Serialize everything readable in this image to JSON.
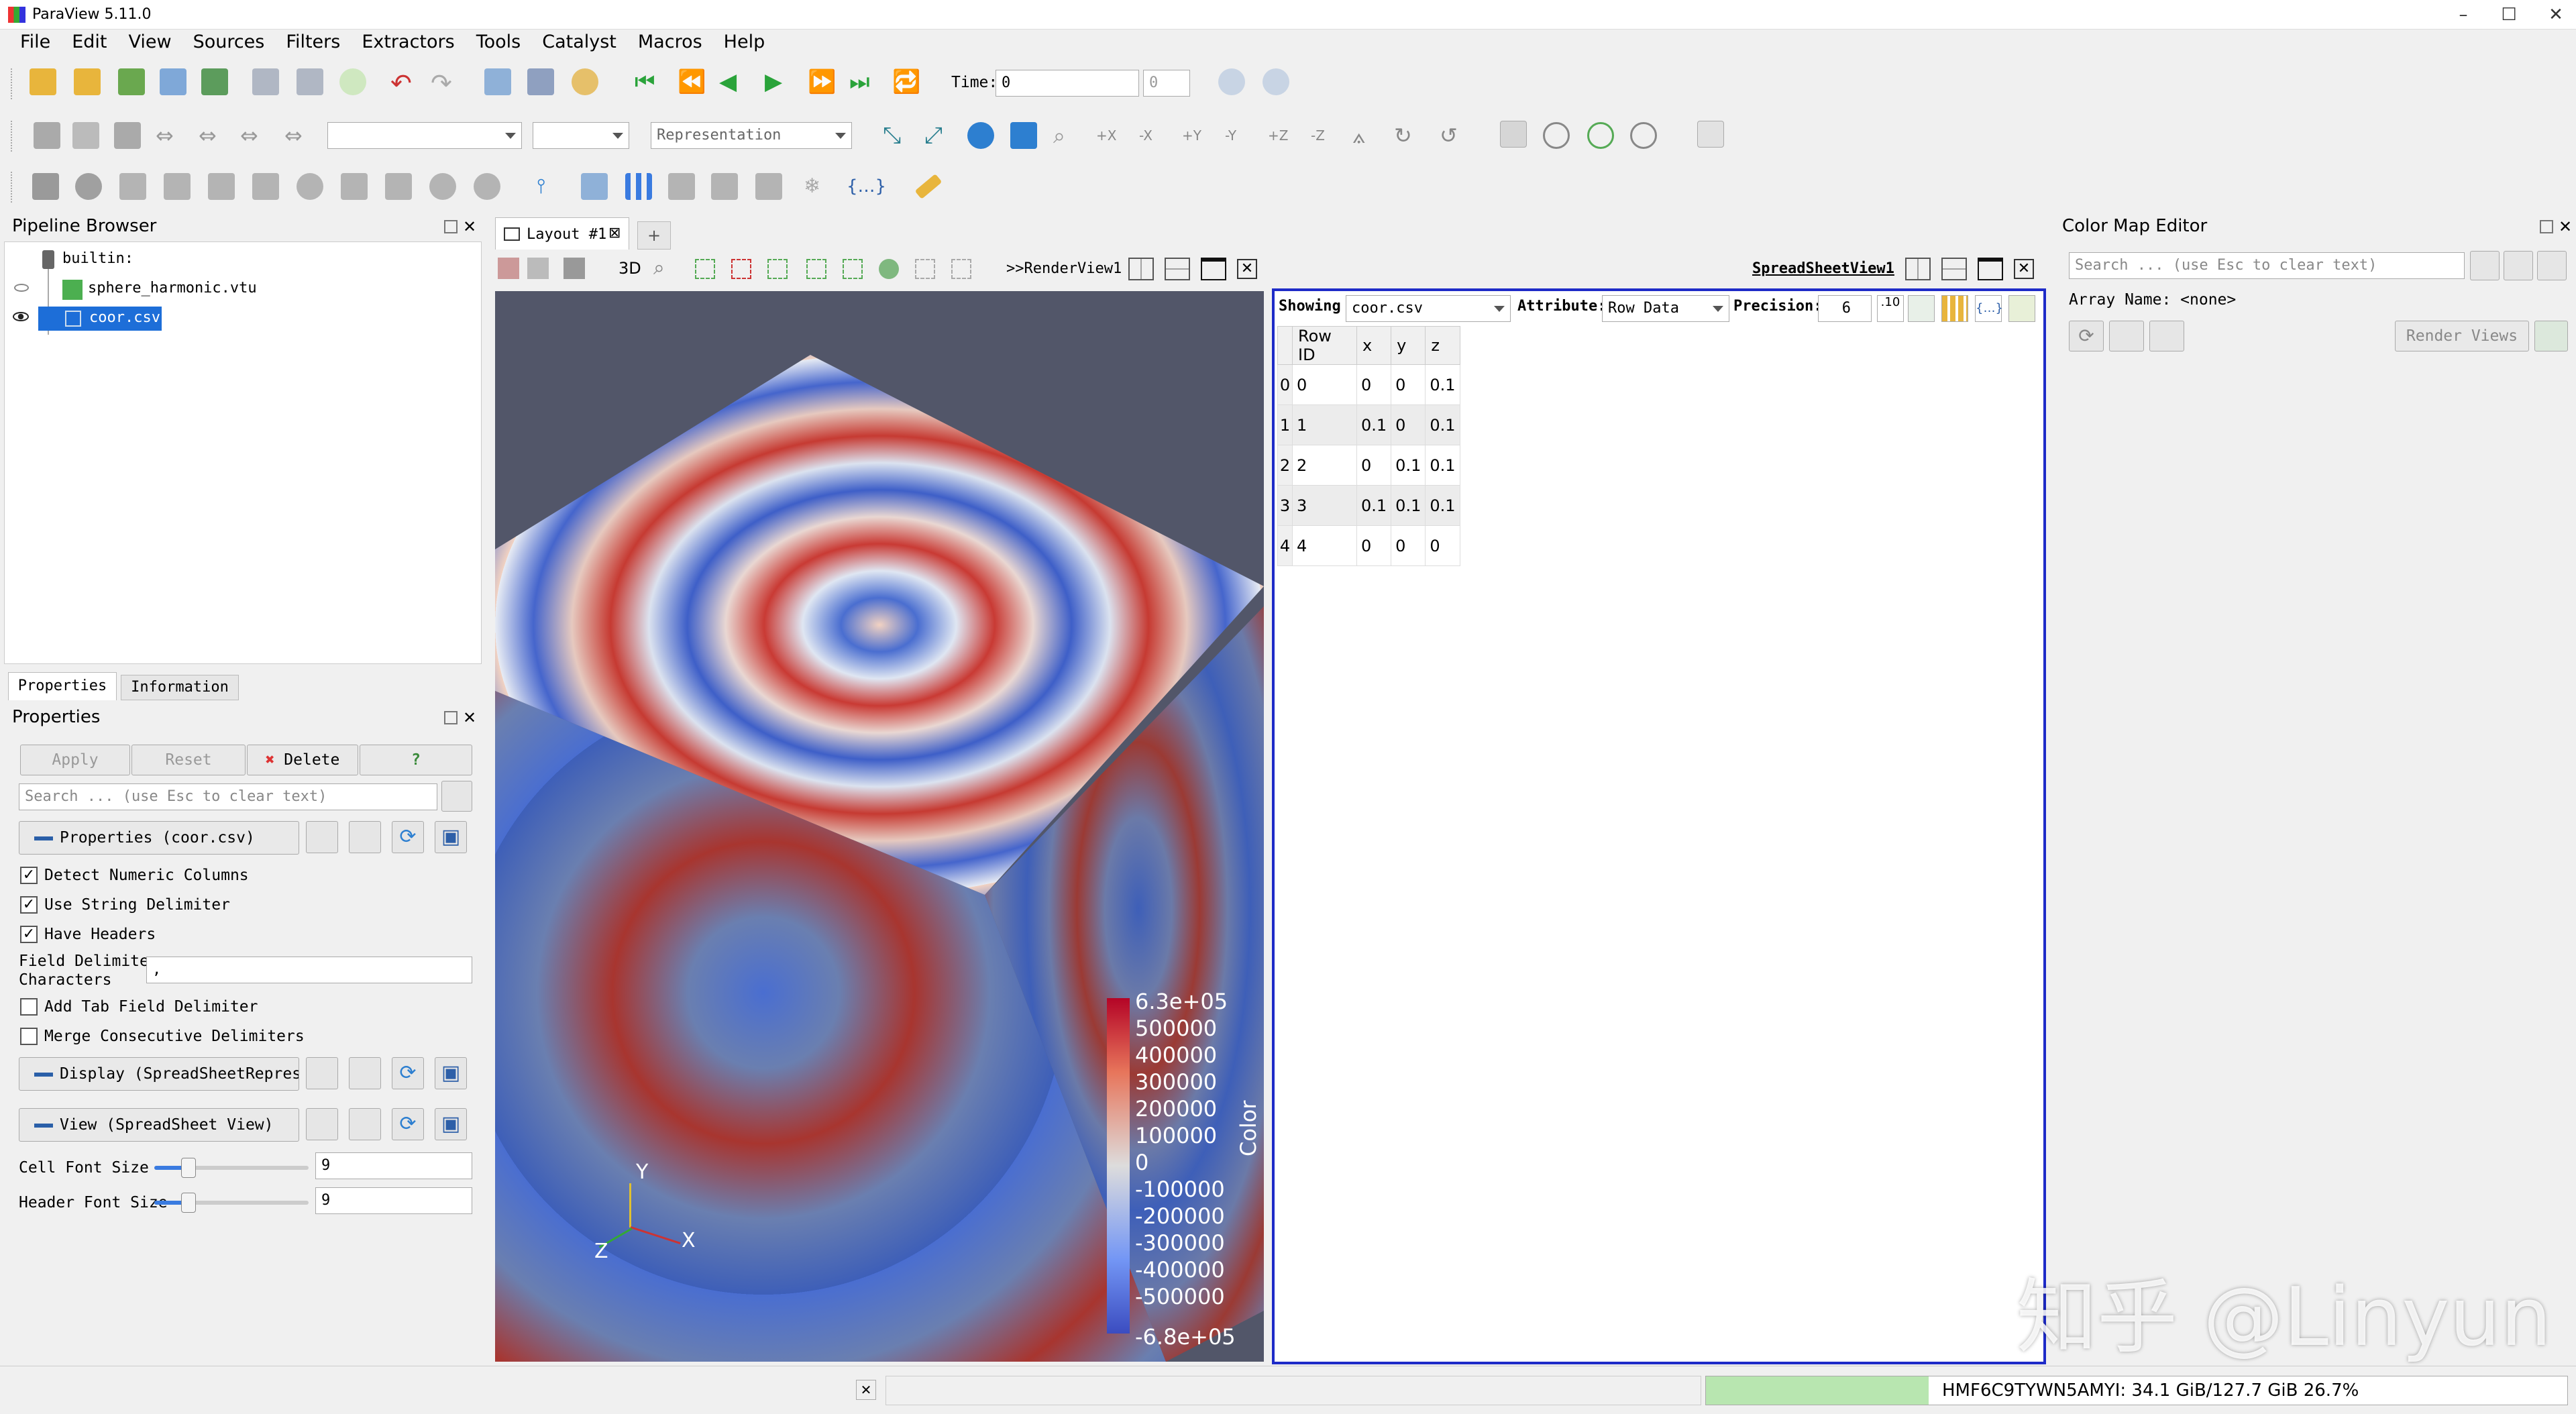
{
  "window": {
    "title": "ParaView 5.11.0",
    "minimize": "–",
    "maximize": "☐",
    "close": "✕"
  },
  "menu": [
    "File",
    "Edit",
    "View",
    "Sources",
    "Filters",
    "Extractors",
    "Tools",
    "Catalyst",
    "Macros",
    "Help"
  ],
  "toolbar": {
    "time_label": "Time:",
    "time_value": "0",
    "time_step": "0",
    "representation_placeholder": "Representation"
  },
  "pipeline": {
    "title": "Pipeline Browser",
    "items": [
      {
        "label": "builtin:"
      },
      {
        "label": "sphere_harmonic.vtu"
      },
      {
        "label": "coor.csv"
      }
    ]
  },
  "tabs": [
    "Properties",
    "Information"
  ],
  "properties": {
    "title": "Properties",
    "apply": "Apply",
    "reset": "Reset",
    "delete": "Delete",
    "help": "?",
    "search_placeholder": "Search ... (use Esc to clear text)",
    "section_props": "Properties (coor.csv)",
    "detect_numeric": "Detect Numeric Columns",
    "use_string_delim": "Use String Delimiter",
    "have_headers": "Have Headers",
    "field_delim_label_1": "Field Delimiter",
    "field_delim_label_2": "Characters",
    "field_delim_value": ",",
    "add_tab": "Add Tab Field Delimiter",
    "merge_consec": "Merge Consecutive Delimiters",
    "section_display": "Display (SpreadSheetRepresentation)",
    "section_view": "View (SpreadSheet View)",
    "cell_font_label": "Cell Font Size",
    "cell_font_value": "9",
    "cell_font_fraction": 0.22,
    "header_font_label": "Header Font Size",
    "header_font_value": "9",
    "header_font_fraction": 0.22
  },
  "layout": {
    "tab": "Layout #1",
    "add_tab": "+",
    "render_view_label": ">>RenderView1",
    "btn_3d": "3D",
    "spreadsheet_label": "SpreadSheetView1"
  },
  "colorbar": {
    "title": "Color",
    "ticks": [
      "6.3e+05",
      "500000",
      "400000",
      "300000",
      "200000",
      "100000",
      "0",
      "-100000",
      "-200000",
      "-300000",
      "-400000",
      "-500000",
      "-6.8e+05"
    ]
  },
  "axes": {
    "y": "Y",
    "x": "X",
    "z": "Z"
  },
  "spreadsheet": {
    "showing_label": "Showing",
    "showing_value": "coor.csv",
    "attribute_label": "Attribute:",
    "attribute_value": "Row Data",
    "precision_label": "Precision:",
    "precision_value": "6",
    "headers": [
      "Row ID",
      "x",
      "y",
      "z"
    ],
    "rows": [
      {
        "index": "0",
        "cells": [
          "0",
          "0",
          "0",
          "0.1"
        ]
      },
      {
        "index": "1",
        "cells": [
          "1",
          "0.1",
          "0",
          "0.1"
        ]
      },
      {
        "index": "2",
        "cells": [
          "2",
          "0",
          "0.1",
          "0.1"
        ]
      },
      {
        "index": "3",
        "cells": [
          "3",
          "0.1",
          "0.1",
          "0.1"
        ]
      },
      {
        "index": "4",
        "cells": [
          "4",
          "0",
          "0",
          "0"
        ]
      }
    ]
  },
  "colormap": {
    "title": "Color Map Editor",
    "search_placeholder": "Search ... (use Esc to clear text)",
    "array_name": "Array Name: <none>",
    "render_views": "Render Views"
  },
  "status": {
    "memory": "HMF6C9TYWN5AMYI: 34.1 GiB/127.7 GiB 26.7%"
  },
  "watermark": "知乎 @Linyun"
}
